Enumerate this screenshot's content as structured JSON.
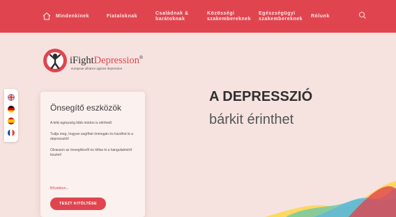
{
  "nav": {
    "items": [
      {
        "label": "Mindenkinek"
      },
      {
        "label": "Fiataloknak"
      },
      {
        "label": "Családnak & barátoknak"
      },
      {
        "label": "Közösségi szakembereknek"
      },
      {
        "label": "Egészségügyi szakembereknek"
      },
      {
        "label": "Rólunk"
      }
    ],
    "home_icon": "home-icon",
    "search_icon": "search-icon"
  },
  "logo": {
    "name_prefix": "iFight",
    "name_accent": "Depression",
    "registered": "®",
    "tagline": "european alliance against depression"
  },
  "languages": [
    "english-flag",
    "german-flag",
    "spanish-flag",
    "french-flag"
  ],
  "card": {
    "title": "Önsegítő eszközök",
    "paragraphs": [
      "A lelki egészség több módon is elérhető.",
      "Tudja meg, hogyan segíthet önmagán és küzdhet le a depressziót!",
      "Olvasson az önsegítésről és töltse ki a hangulatmérő tesztet!"
    ],
    "more_link": "Bővebben...",
    "button": "TESZT KITÖLTÉSE"
  },
  "hero": {
    "title": "A DEPRESSZIÓ",
    "subtitle": "bárkit érinthet"
  },
  "colors": {
    "brand_red": "#e0454f",
    "background": "#f6e3e0"
  }
}
